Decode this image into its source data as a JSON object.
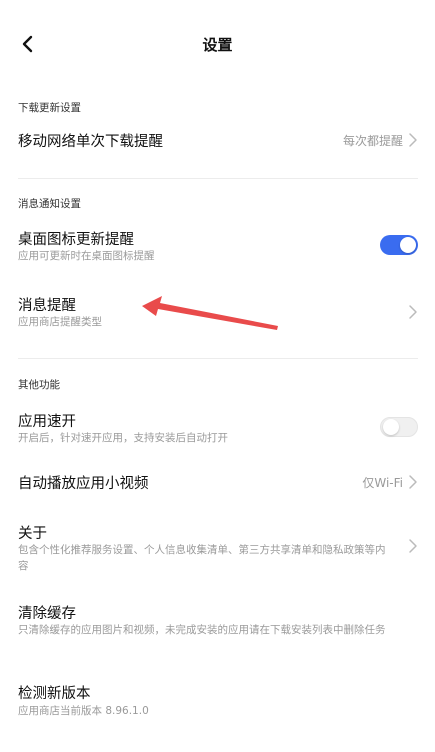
{
  "header": {
    "title": "设置"
  },
  "sections": {
    "download": {
      "label": "下载更新设置",
      "mobile_download": {
        "title": "移动网络单次下载提醒",
        "value": "每次都提醒"
      }
    },
    "notify": {
      "label": "消息通知设置",
      "desktop_badge": {
        "title": "桌面图标更新提醒",
        "subtitle": "应用可更新时在桌面图标提醒",
        "enabled": true
      },
      "message_reminder": {
        "title": "消息提醒",
        "subtitle": "应用商店提醒类型"
      }
    },
    "other": {
      "label": "其他功能",
      "quick_open": {
        "title": "应用速开",
        "subtitle": "开启后，针对速开应用，支持安装后自动打开",
        "enabled": false
      },
      "autoplay": {
        "title": "自动播放应用小视频",
        "value": "仅Wi-Fi"
      },
      "about": {
        "title": "关于",
        "subtitle": "包含个性化推荐服务设置、个人信息收集清单、第三方共享清单和隐私政策等内容"
      },
      "clear_cache": {
        "title": "清除缓存",
        "subtitle": "只清除缓存的应用图片和视频，未完成安装的应用请在下载安装列表中删除任务"
      },
      "check_update": {
        "title": "检测新版本",
        "subtitle": "应用商店当前版本 8.96.1.0"
      }
    }
  },
  "colors": {
    "accent": "#3a6cf0",
    "annotation": "#e94b4b"
  }
}
